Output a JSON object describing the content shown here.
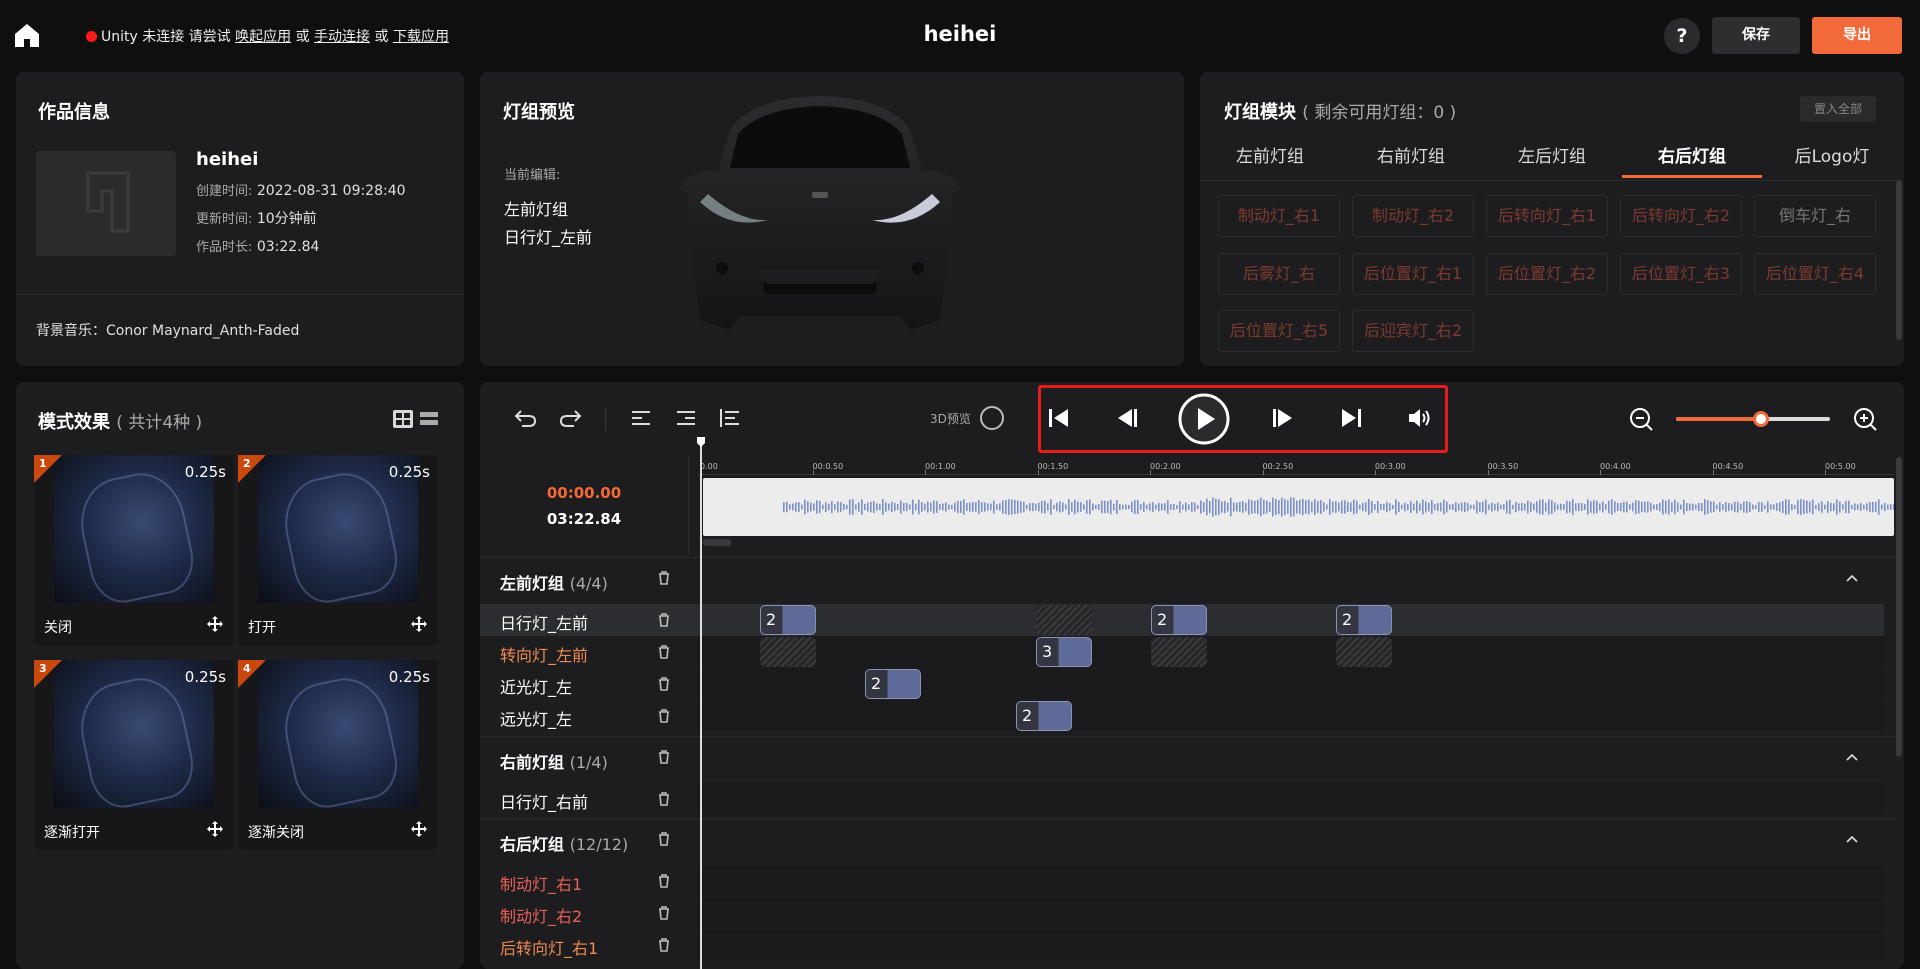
{
  "topbar": {
    "unity_prefix": "Unity 未连接 请尝试",
    "launch_app": "唤起应用",
    "or1": "或",
    "manual_connect": "手动连接",
    "or2": "或",
    "download_app": "下载应用",
    "title": "heihei",
    "help": "?",
    "save": "保存",
    "export": "导出",
    "status_color": "#ff1a1a",
    "accent": "#f16a37"
  },
  "work_info": {
    "title": "作品信息",
    "name": "heihei",
    "created_label": "创建时间:",
    "created_value": "2022-08-31 09:28:40",
    "updated_label": "更新时间:",
    "updated_value": "10分钟前",
    "duration_label": "作品时长:",
    "duration_value": "03:22.84",
    "bgm": "背景音乐：Conor Maynard_Anth-Faded"
  },
  "preview": {
    "title": "灯组预览",
    "current_edit_label": "当前编辑:",
    "current_group": "左前灯组",
    "current_light": "日行灯_左前"
  },
  "module": {
    "title": "灯组模块",
    "subtitle": "( 剩余可用灯组：0 )",
    "replace_all": "置入全部",
    "tabs": [
      "左前灯组",
      "右前灯组",
      "左后灯组",
      "右后灯组",
      "后Logo灯"
    ],
    "active_tab": "右后灯组",
    "chips": [
      "制动灯_右1",
      "制动灯_右2",
      "后转向灯_右1",
      "后转向灯_右2",
      "倒车灯_右",
      "后雾灯_右",
      "后位置灯_右1",
      "后位置灯_右2",
      "后位置灯_右3",
      "后位置灯_右4",
      "后位置灯_右5",
      "后迎宾灯_右2"
    ]
  },
  "modes": {
    "title": "模式效果",
    "subtitle": "( 共计4种 )",
    "items": [
      {
        "num": "1",
        "dur": "0.25s",
        "label": "关闭"
      },
      {
        "num": "2",
        "dur": "0.25s",
        "label": "打开"
      },
      {
        "num": "3",
        "dur": "0.25s",
        "label": "逐渐打开"
      },
      {
        "num": "4",
        "dur": "0.25s",
        "label": "逐渐关闭"
      }
    ]
  },
  "timeline": {
    "preview3d": "3D预览",
    "current_time": "00:00.00",
    "total_time": "03:22.84",
    "zoom_level": 0.55,
    "ticks": [
      "0.00",
      "00:0.50",
      "00:1.00",
      "00:1.50",
      "00:2.00",
      "00:2.50",
      "00:3.00",
      "00:3.50",
      "00:4.00",
      "00:4.50",
      "00:5.00"
    ],
    "groups": [
      {
        "name": "左前灯组",
        "count": "(4/4)"
      },
      {
        "name": "右前灯组",
        "count": "(1/4)"
      },
      {
        "name": "右后灯组",
        "count": "(12/12)"
      }
    ],
    "tracks": [
      {
        "label": "日行灯_左前",
        "color": "#ffffff"
      },
      {
        "label": "转向灯_左前",
        "color": "#f08a50"
      },
      {
        "label": "近光灯_左",
        "color": "#ffffff"
      },
      {
        "label": "远光灯_左",
        "color": "#ffffff"
      },
      {
        "label": "日行灯_右前",
        "color": "#ffffff"
      },
      {
        "label": "制动灯_右1",
        "color": "#e8605a"
      },
      {
        "label": "制动灯_右2",
        "color": "#e8605a"
      },
      {
        "label": "后转向灯_右1",
        "color": "#f08a50"
      }
    ],
    "clips": [
      "2",
      "2",
      "2",
      "3",
      "2",
      "2"
    ]
  }
}
